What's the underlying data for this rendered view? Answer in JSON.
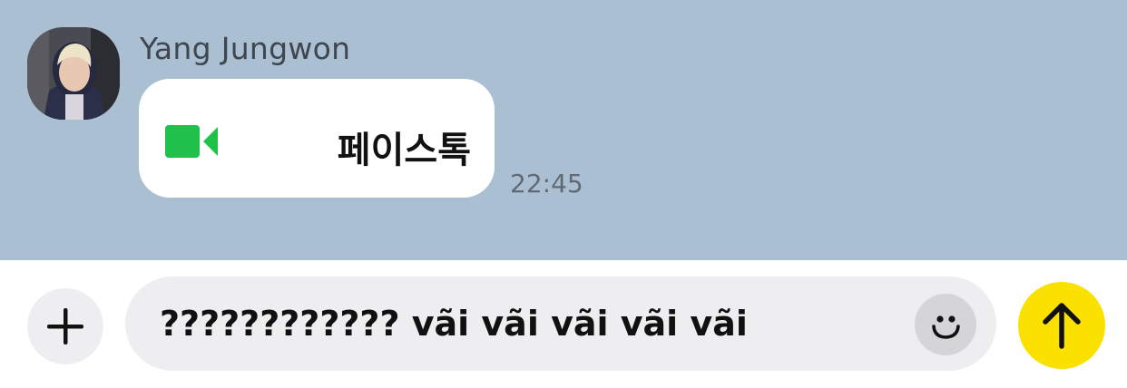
{
  "conversation": {
    "sender_name": "Yang Jungwon",
    "message": {
      "icon": "video-camera-icon",
      "label": "페이스톡",
      "time": "22:45"
    }
  },
  "composer": {
    "add_icon": "plus-icon",
    "input_value": "???????????? vãi vãi vãi vãi vãi",
    "emoji_icon": "smiley-icon",
    "send_icon": "arrow-up-icon"
  },
  "colors": {
    "chat_background": "#aabfd1",
    "facetime_green": "#1fc14a",
    "send_yellow": "#fae100"
  }
}
